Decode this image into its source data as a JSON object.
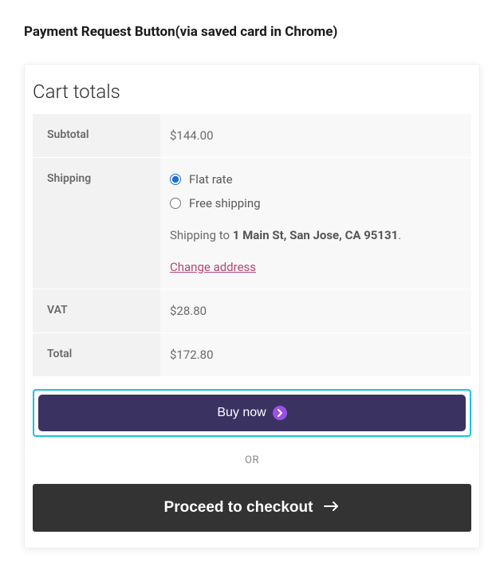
{
  "page": {
    "title": "Payment Request Button(via saved card in Chrome)"
  },
  "cart": {
    "heading": "Cart totals",
    "rows": {
      "subtotal": {
        "label": "Subtotal",
        "value": "$144.00"
      },
      "shipping": {
        "label": "Shipping",
        "options": {
          "flat_rate": "Flat rate",
          "free_shipping": "Free shipping"
        },
        "destination_prefix": "Shipping to ",
        "destination_address": "1 Main St, San Jose, CA 95131",
        "destination_suffix": ".",
        "change_link": "Change address"
      },
      "vat": {
        "label": "VAT",
        "value": "$28.80"
      },
      "total": {
        "label": "Total",
        "value": "$172.80"
      }
    }
  },
  "buttons": {
    "buy_now": "Buy now",
    "or_label": "OR",
    "checkout": "Proceed to checkout"
  }
}
